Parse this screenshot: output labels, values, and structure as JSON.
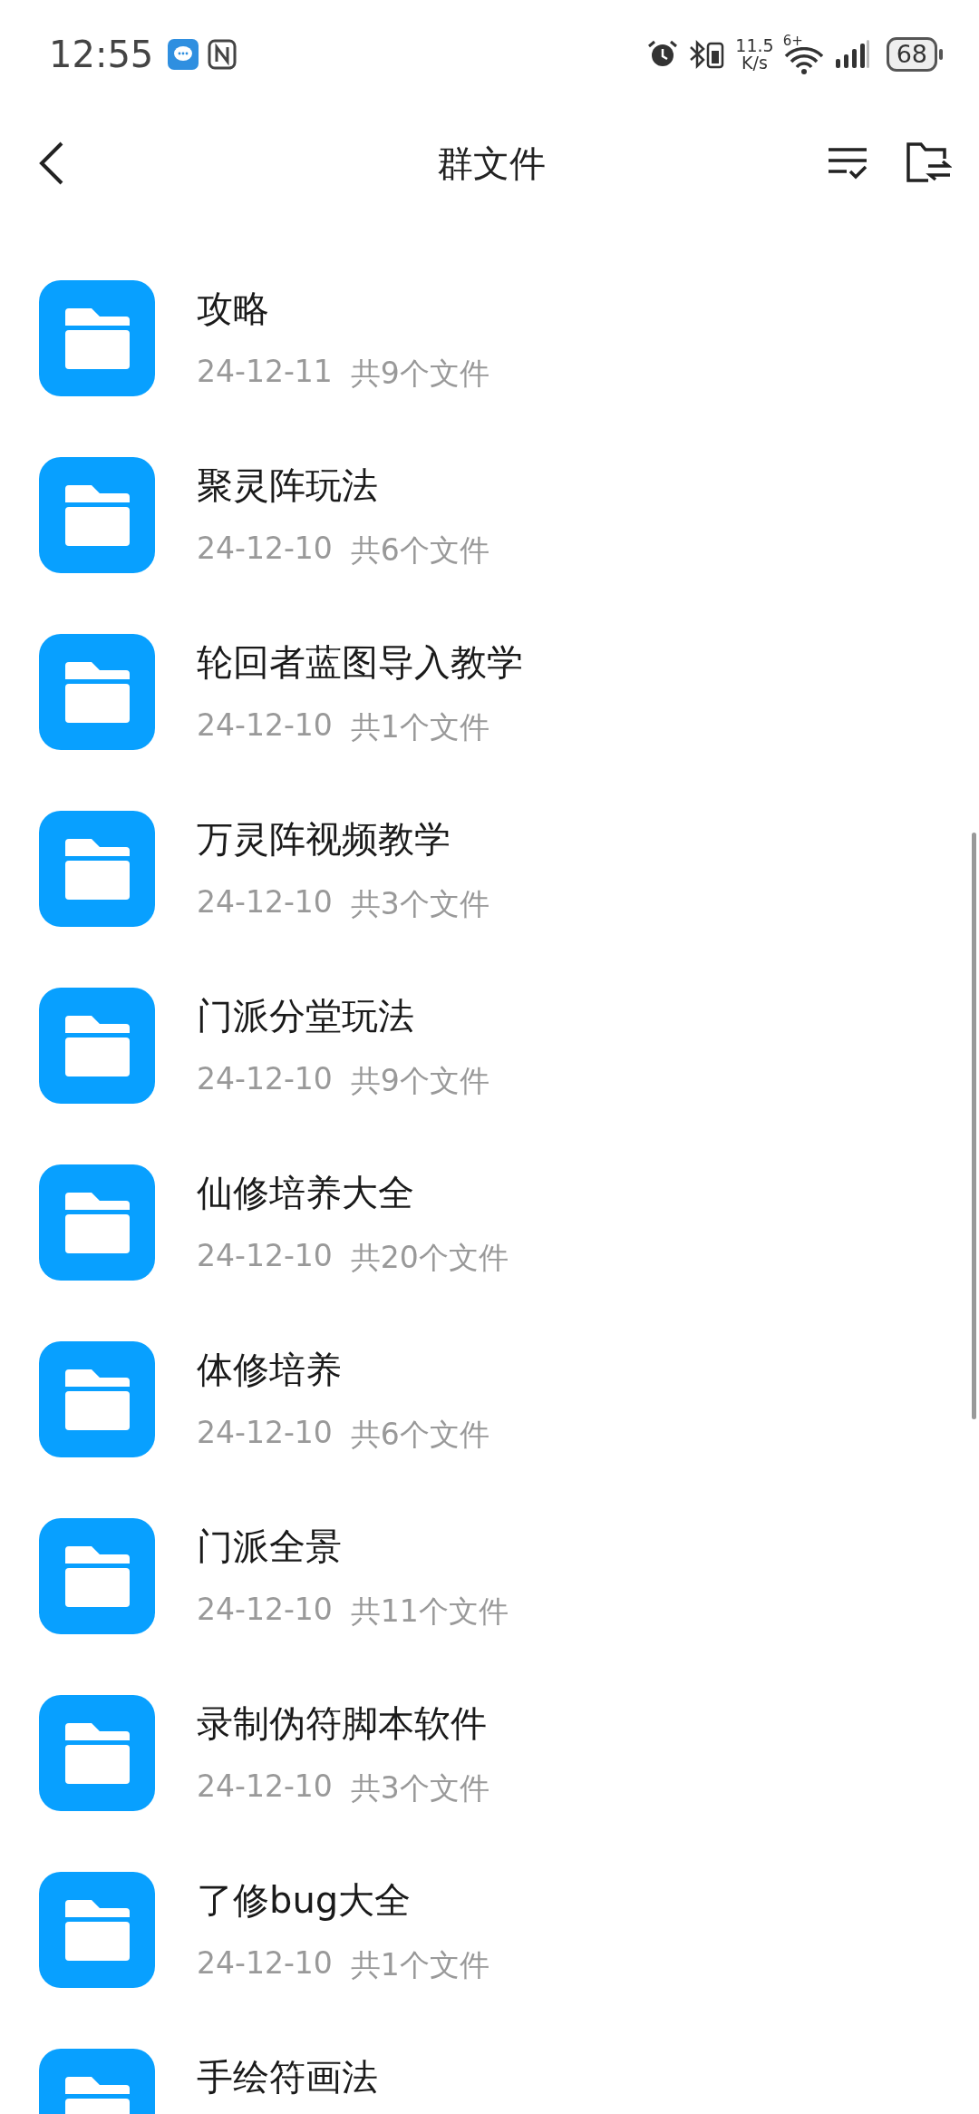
{
  "status_bar": {
    "time": "12:55",
    "speed_value": "11.5",
    "speed_unit": "K/s",
    "network": "6+",
    "battery": "68"
  },
  "header": {
    "title": "群文件"
  },
  "folders": [
    {
      "name": "攻略",
      "date": "24-12-11",
      "count": "共9个文件"
    },
    {
      "name": "聚灵阵玩法",
      "date": "24-12-10",
      "count": "共6个文件"
    },
    {
      "name": "轮回者蓝图导入教学",
      "date": "24-12-10",
      "count": "共1个文件"
    },
    {
      "name": "万灵阵视频教学",
      "date": "24-12-10",
      "count": "共3个文件"
    },
    {
      "name": "门派分堂玩法",
      "date": "24-12-10",
      "count": "共9个文件"
    },
    {
      "name": "仙修培养大全",
      "date": "24-12-10",
      "count": "共20个文件"
    },
    {
      "name": "体修培养",
      "date": "24-12-10",
      "count": "共6个文件"
    },
    {
      "name": "门派全景",
      "date": "24-12-10",
      "count": "共11个文件"
    },
    {
      "name": "录制伪符脚本软件",
      "date": "24-12-10",
      "count": "共3个文件"
    },
    {
      "name": "了修bug大全",
      "date": "24-12-10",
      "count": "共1个文件"
    },
    {
      "name": "手绘符画法"
    }
  ]
}
